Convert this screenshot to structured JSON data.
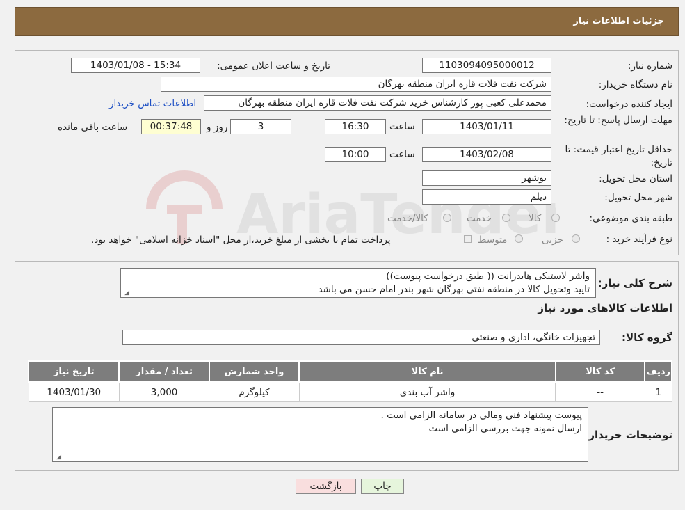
{
  "header": {
    "title": "جزئیات اطلاعات نیاز"
  },
  "form": {
    "need_number": {
      "label": "شماره نیاز:",
      "value": "1103094095000012"
    },
    "announce_datetime": {
      "label": "تاریخ و ساعت اعلان عمومی:",
      "value": "1403/01/08 - 15:34"
    },
    "buyer_org": {
      "label": "نام دستگاه خریدار:",
      "value": "شرکت نفت فلات قاره ایران منطقه بهرگان"
    },
    "requester": {
      "label": "ایجاد کننده درخواست:",
      "value": "محمدعلی کعبی پور کارشناس خرید شرکت نفت فلات قاره ایران منطقه بهرگان",
      "contact_link": "اطلاعات تماس خریدار"
    },
    "reply_deadline": {
      "label": "مهلت ارسال پاسخ: تا تاریخ:",
      "date": "1403/01/11",
      "time_label": "ساعت",
      "time": "16:30",
      "days": "3",
      "days_label": "روز و",
      "remaining": "00:37:48",
      "remaining_label": "ساعت باقی مانده"
    },
    "price_validity": {
      "label": "حداقل تاریخ اعتبار قیمت: تا تاریخ:",
      "date": "1403/02/08",
      "time_label": "ساعت",
      "time": "10:00"
    },
    "province": {
      "label": "استان محل تحویل:",
      "value": "بوشهر"
    },
    "city": {
      "label": "شهر محل تحویل:",
      "value": "دیلم"
    },
    "category": {
      "label": "طبقه بندی موضوعی:",
      "options": [
        "کالا",
        "خدمت",
        "کالا/خدمت"
      ]
    },
    "process": {
      "label": "نوع فرآیند خرید :",
      "options": [
        "جزیی",
        "متوسط"
      ],
      "note": "پرداخت تمام یا بخشی از مبلغ خرید،از محل \"اسناد خزانه اسلامی\" خواهد بود."
    }
  },
  "description": {
    "label": "شرح کلی نیاز:",
    "lines": [
      "واشر لاستیکی هایدرانت  (( طبق درخواست پیوست))",
      "تایید وتحویل کالا در منطقه نفتی بهرگان شهر بندر امام حسن می باشد"
    ]
  },
  "goods_section": {
    "title": "اطلاعات کالاهای مورد نیاز"
  },
  "goods_group": {
    "label": "گروه کالا:",
    "value": "تجهیزات خانگی، اداری و صنعتی"
  },
  "table": {
    "headers": [
      "ردیف",
      "کد کالا",
      "نام کالا",
      "واحد شمارش",
      "تعداد / مقدار",
      "تاریخ نیاز"
    ],
    "rows": [
      [
        "1",
        "--",
        "واشر آب بندی",
        "کیلوگرم",
        "3,000",
        "1403/01/30"
      ]
    ]
  },
  "buyer_notes": {
    "label": "توضیحات خریدار:",
    "lines": [
      "پیوست پیشنهاد فنی ومالی در سامانه الزامی است .",
      "ارسال نمونه جهت بررسی الزامی است"
    ]
  },
  "buttons": {
    "print": "چاپ",
    "back": "بازگشت"
  },
  "watermark": {
    "text": "AriaTender.neT"
  },
  "colors": {
    "header_bg": "#8c6a3f",
    "table_header_bg": "#7d7d7d",
    "remaining_bg": "#fefed2",
    "back_button_bg": "#f9dede",
    "print_button_bg": "#e6f5dc",
    "link": "#1d4fc4"
  }
}
